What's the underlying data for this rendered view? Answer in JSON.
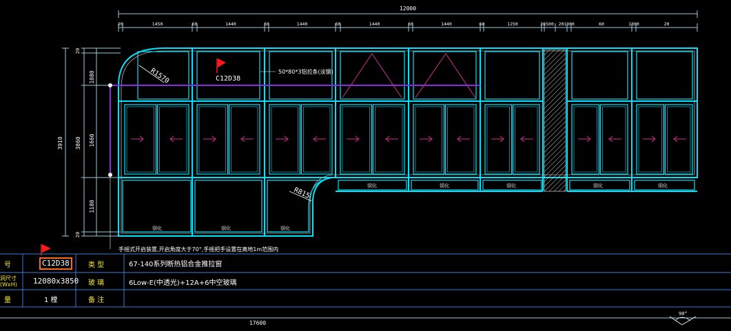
{
  "colors": {
    "background": "#000000",
    "frame": "#00e5ff",
    "frame_inner": "#ffffff",
    "dimension": "#9ec9d9",
    "handle": "#d03090",
    "rail": "#8a2be2",
    "flag": "#ff1a1a",
    "table_line": "#3a7bd5",
    "table_label": "#f5e640",
    "selection": "#ff6a1a"
  },
  "dimensions": {
    "overall_width": "12000",
    "top_segments": [
      "20",
      "1450",
      "60",
      "1440",
      "60",
      "1440",
      "60",
      "1440",
      "60",
      "1440",
      "60",
      "1250",
      "20",
      "500",
      "20",
      "1300",
      "60",
      "1300",
      "20"
    ],
    "left_overall": "3910",
    "left_segments": [
      "20",
      "1080",
      "1660",
      "1180",
      "20"
    ],
    "left_inner": "3860",
    "bottom_overall": "17600",
    "angle": "90°"
  },
  "annotations": {
    "radius_top": "R1570",
    "radius_bottom": "R815",
    "window_tag": "C12D38",
    "rail_note": "50*80*3铝拉条(淡钢)",
    "handle_note": "手摇式开启装置,开启角度大于70°,手摇把手设置在离地1m范围内",
    "tempered_label": "钢化"
  },
  "table": {
    "rows": [
      {
        "label_left": "号",
        "value": "C12D38",
        "label_mid": "类 型",
        "desc": "67-140系列断热铝合金推拉窗"
      },
      {
        "label_left": "洞尺寸 (WxH)",
        "value": "12080x3850",
        "label_mid": "玻 璃",
        "desc": "6Low-E(中透光)+12A+6中空玻璃"
      },
      {
        "label_left": "量",
        "value": "1 樘",
        "label_mid": "备 注",
        "desc": ""
      }
    ]
  }
}
